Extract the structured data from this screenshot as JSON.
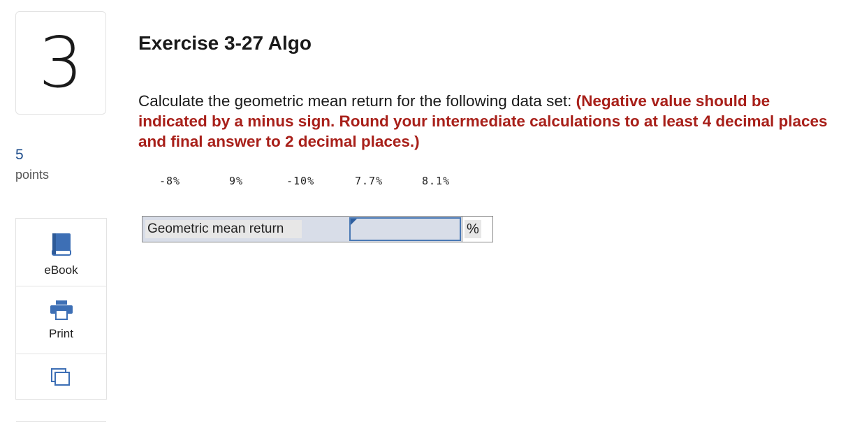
{
  "question": {
    "number": "3",
    "points_value": "5",
    "points_label": "points",
    "title": "Exercise 3-27 Algo",
    "prompt_text": "Calculate the geometric mean return for the following data set: ",
    "prompt_instructions": "(Negative value should be indicated by a minus sign. Round your intermediate calculations to at least 4 decimal places and final answer to 2 decimal places.)",
    "returns": [
      "-8%",
      "9%",
      "-10%",
      "7.7%",
      "8.1%"
    ]
  },
  "tools": [
    {
      "label": "eBook",
      "icon": "book-icon"
    },
    {
      "label": "Print",
      "icon": "printer-icon"
    },
    {
      "label": "",
      "icon": "references-icon"
    }
  ],
  "answer": {
    "label": "Geometric mean return",
    "value": "",
    "unit": "%"
  },
  "colors": {
    "emphasis": "#a8201a",
    "points": "#1f4e8c",
    "icon_blue": "#3d6fb5",
    "input_bg": "#d8dde8"
  }
}
